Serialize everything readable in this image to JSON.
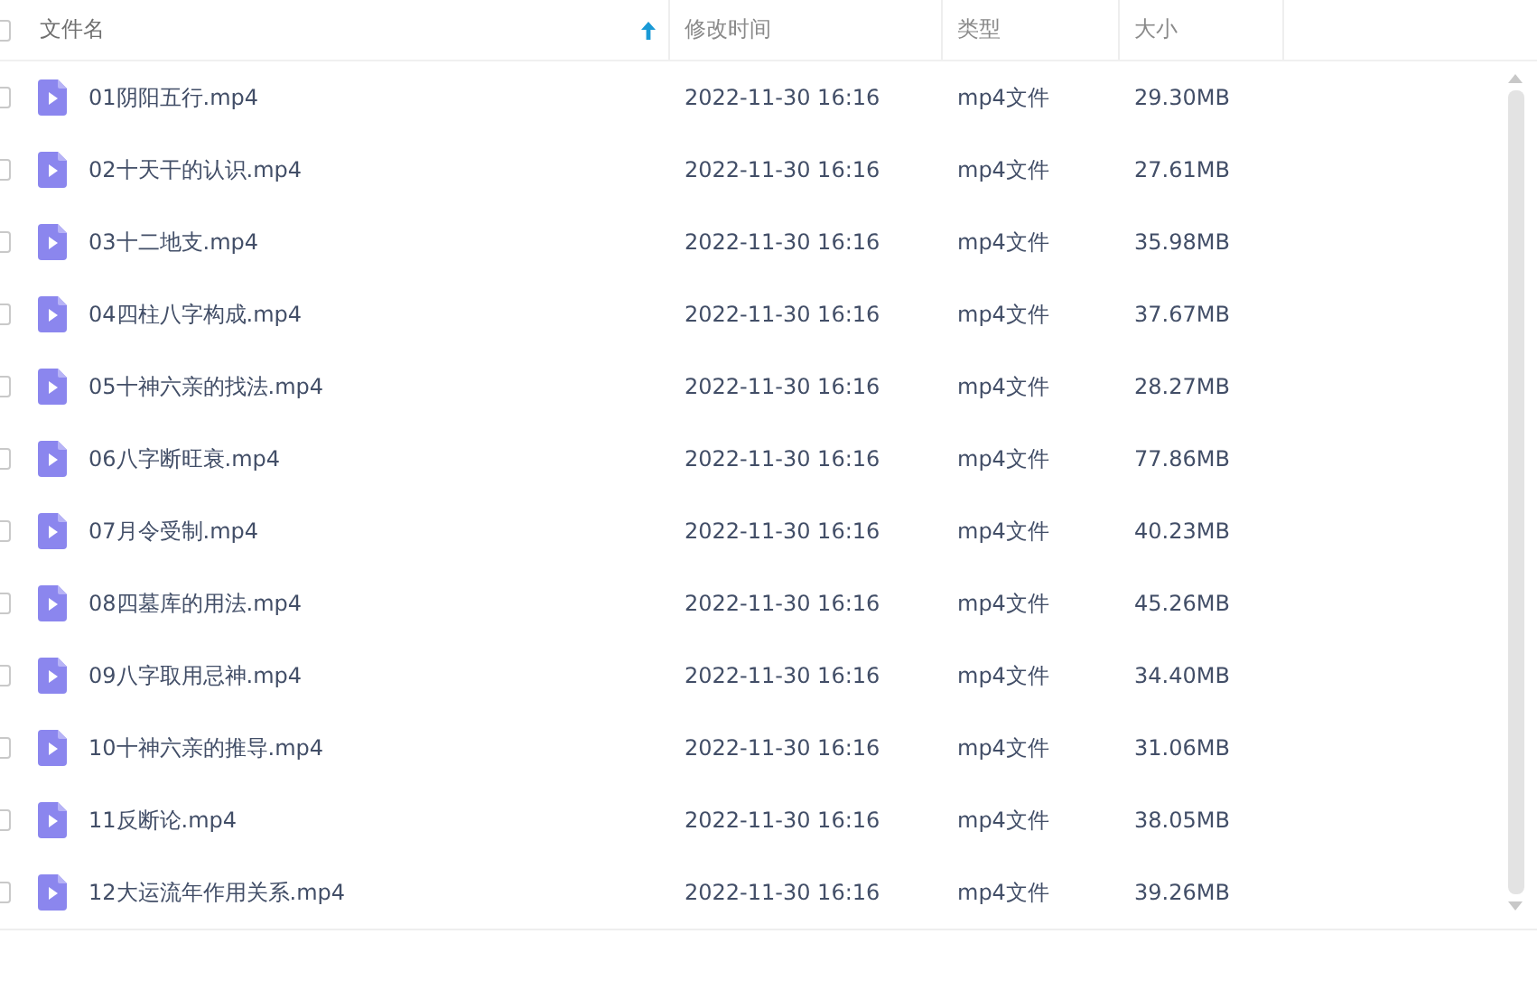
{
  "table": {
    "header_checkbox": {
      "checked": false
    },
    "columns": [
      {
        "label": "文件名",
        "sorted": true
      },
      {
        "label": "修改时间",
        "sorted": false
      },
      {
        "label": "类型",
        "sorted": false
      },
      {
        "label": "大小",
        "sorted": false
      }
    ],
    "rows": [
      {
        "checked": false,
        "name": "01阴阳五行.mp4",
        "modified": "2022-11-30 16:16",
        "type": "mp4文件",
        "size": "29.30MB"
      },
      {
        "checked": false,
        "name": "02十天干的认识.mp4",
        "modified": "2022-11-30 16:16",
        "type": "mp4文件",
        "size": "27.61MB"
      },
      {
        "checked": false,
        "name": "03十二地支.mp4",
        "modified": "2022-11-30 16:16",
        "type": "mp4文件",
        "size": "35.98MB"
      },
      {
        "checked": false,
        "name": "04四柱八字构成.mp4",
        "modified": "2022-11-30 16:16",
        "type": "mp4文件",
        "size": "37.67MB"
      },
      {
        "checked": false,
        "name": "05十神六亲的找法.mp4",
        "modified": "2022-11-30 16:16",
        "type": "mp4文件",
        "size": "28.27MB"
      },
      {
        "checked": false,
        "name": "06八字断旺衰.mp4",
        "modified": "2022-11-30 16:16",
        "type": "mp4文件",
        "size": "77.86MB"
      },
      {
        "checked": false,
        "name": "07月令受制.mp4",
        "modified": "2022-11-30 16:16",
        "type": "mp4文件",
        "size": "40.23MB"
      },
      {
        "checked": false,
        "name": "08四墓库的用法.mp4",
        "modified": "2022-11-30 16:16",
        "type": "mp4文件",
        "size": "45.26MB"
      },
      {
        "checked": false,
        "name": "09八字取用忌神.mp4",
        "modified": "2022-11-30 16:16",
        "type": "mp4文件",
        "size": "34.40MB"
      },
      {
        "checked": false,
        "name": "10十神六亲的推导.mp4",
        "modified": "2022-11-30 16:16",
        "type": "mp4文件",
        "size": "31.06MB"
      },
      {
        "checked": false,
        "name": "11反断论.mp4",
        "modified": "2022-11-30 16:16",
        "type": "mp4文件",
        "size": "38.05MB"
      },
      {
        "checked": false,
        "name": "12大运流年作用关系.mp4",
        "modified": "2022-11-30 16:16",
        "type": "mp4文件",
        "size": "39.26MB"
      }
    ]
  }
}
